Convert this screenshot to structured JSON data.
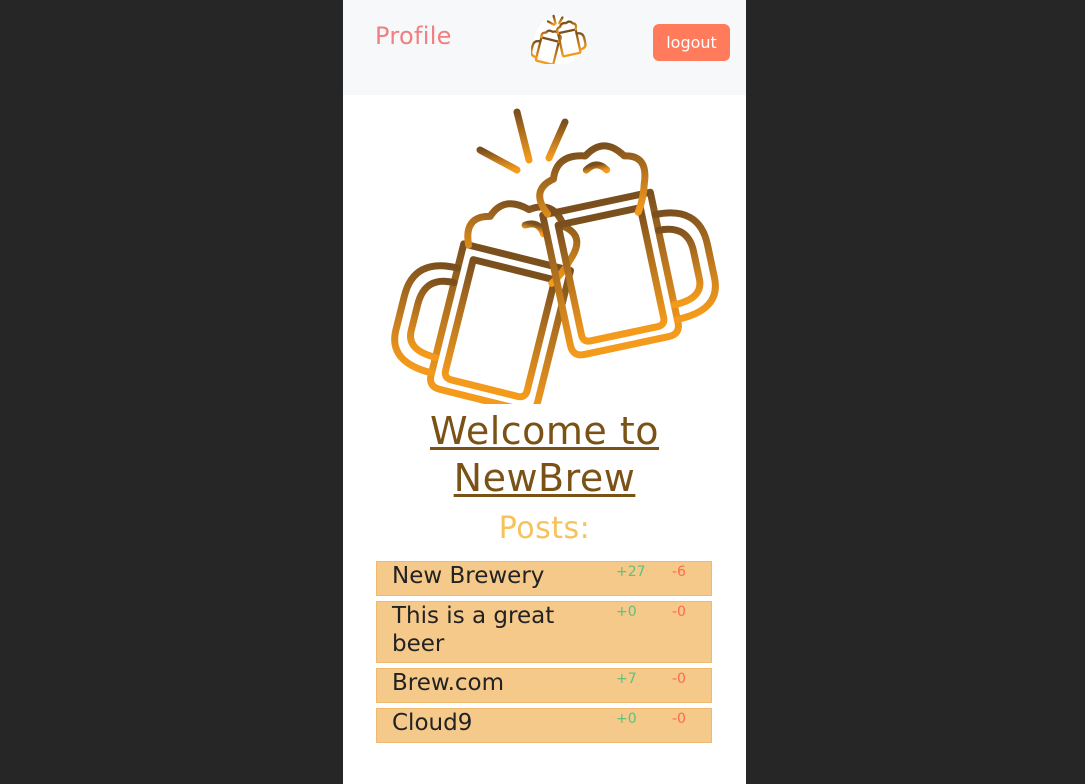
{
  "nav": {
    "profile_label": "Profile",
    "logout_label": "logout"
  },
  "hero": {
    "welcome_text": "Welcome to NewBrew",
    "posts_heading": "Posts:"
  },
  "posts": [
    {
      "title": "New Brewery",
      "upvotes": "+27",
      "downvotes": "-6"
    },
    {
      "title": "This is a great beer",
      "upvotes": "+0",
      "downvotes": "-0"
    },
    {
      "title": "Brew.com",
      "upvotes": "+7",
      "downvotes": "-0"
    },
    {
      "title": "Cloud9",
      "upvotes": "+0",
      "downvotes": "-0"
    }
  ],
  "colors": {
    "page_background": "#262626",
    "navbar_background": "#f7f8fa",
    "profile_link": "#f08080",
    "logout_button": "#ff7b5c",
    "welcome_text": "#7a5216",
    "posts_heading": "#f7c25a",
    "post_card": "#f5c98a",
    "upvote": "#5ec27a",
    "downvote": "#ff6b4a"
  },
  "icons": {
    "nav_logo": "beer-mugs-cheers-icon",
    "hero_image": "beer-mugs-cheers-illustration"
  }
}
